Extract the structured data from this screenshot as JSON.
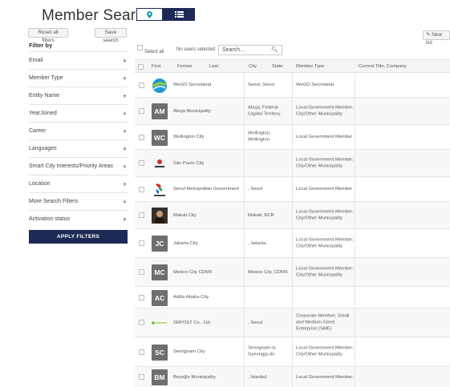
{
  "title": "Member Search",
  "view_toggle": {
    "map_icon": "map-pin-icon",
    "list_icon": "list-icon"
  },
  "sidebar": {
    "reset_label": "Reset all filters",
    "save_search_label": "Save search",
    "filter_by": "Filter by",
    "filters": [
      "Email",
      "Member Type",
      "Entity Name",
      "YearJoined",
      "Career",
      "Languages",
      "Smart City Interests/Priority Areas",
      "Location",
      "More Search Filters",
      "Activation status"
    ],
    "apply_label": "APPLY FILTERS"
  },
  "toolbar": {
    "select_all": "Select all",
    "no_users": "No users selected",
    "search_placeholder": "Search...",
    "add_list": "New list"
  },
  "columns": [
    "First",
    "Former",
    "Last",
    "City",
    "State",
    "Member Type",
    "Current Title, Company"
  ],
  "rows": [
    {
      "avatar": "",
      "name": "WeGO Secretariat",
      "city": "Seoul, Seoul",
      "type": "WeGO Secretariat"
    },
    {
      "avatar": "AM",
      "name": "Abuja Municipality",
      "city": "Abuja, Federal Capital Territory",
      "type": "Local Government Member; City/Other Municipality"
    },
    {
      "avatar": "WC",
      "name": "Wellington City",
      "city": "Wellington, Wellington",
      "type": "Local Government Member"
    },
    {
      "avatar": "",
      "name": "São Paulo City",
      "city": "",
      "type": "Local Government Member; City/Other Municipality"
    },
    {
      "avatar": "",
      "name": "Seoul Metropolitan Government",
      "city": ", Seoul",
      "type": "Local Government Member"
    },
    {
      "avatar": "",
      "name": "Makati City",
      "city": "Makati, NCR",
      "type": "Local Government Member; City/Other Municipality"
    },
    {
      "avatar": "JC",
      "name": "Jakarta City",
      "city": ", Jakarta",
      "type": "Local Government Member; City/Other Municipality"
    },
    {
      "avatar": "MC",
      "name": "Mexico City CDMX",
      "city": "Mexico City, CDMX",
      "type": "Local Government Member; City/Other Municipality"
    },
    {
      "avatar": "AC",
      "name": "Addis Ababa City",
      "city": "",
      "type": ""
    },
    {
      "avatar": "",
      "name": "SRPOST Co., Ltd.",
      "city": ", Seoul",
      "type": "Corporate Member; Small and Medium-Sized Enterprise (SME)"
    },
    {
      "avatar": "SC",
      "name": "Seongnam City",
      "city": "Seongnam-si, Gyeonggi-do",
      "type": "Local Government Member; City/Other Municipality"
    },
    {
      "avatar": "BM",
      "name": "Beyoğlu Municipality",
      "city": ", İstanbul",
      "type": "Local Government Member;"
    }
  ]
}
